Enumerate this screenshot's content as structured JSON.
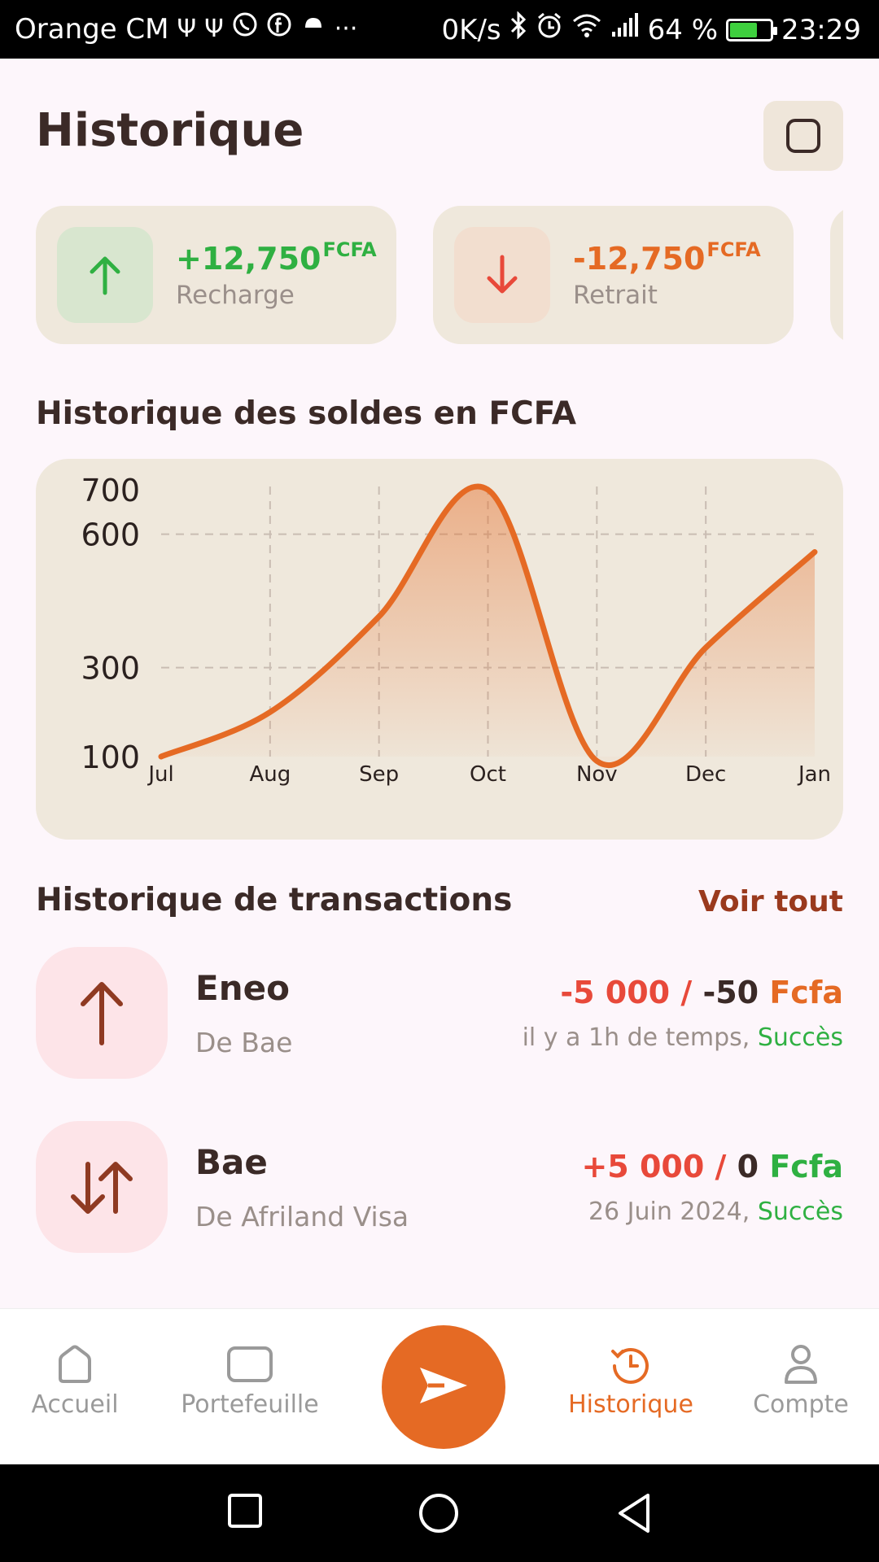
{
  "status_bar": {
    "carrier": "Orange CM",
    "network_speed": "0K/s",
    "battery_percent": "64 %",
    "battery_level": 0.64,
    "time": "23:29",
    "icons": [
      "usb-icon",
      "usb-icon",
      "whatsapp-icon",
      "facebook-icon",
      "notification-icon",
      "more-icon",
      "bluetooth-icon",
      "alarm-icon",
      "wifi-icon",
      "signal-icon",
      "battery-icon"
    ]
  },
  "header": {
    "title": "Historique",
    "action_icon": "square-icon"
  },
  "summary_cards": [
    {
      "amount": "+12,750",
      "currency": "FCFA",
      "label": "Recharge",
      "icon": "arrow-up-icon",
      "color": "#2fb042",
      "icon_bg": "#d8e6cf"
    },
    {
      "amount": "-12,750",
      "currency": "FCFA",
      "label": "Retrait",
      "icon": "arrow-down-icon",
      "color": "#e56a24",
      "icon_bg": "#f2decf"
    }
  ],
  "balance_section": {
    "title": "Historique des soldes en FCFA"
  },
  "chart_data": {
    "type": "area",
    "title": "Historique des soldes en FCFA",
    "x": [
      "Jul",
      "Aug",
      "Sep",
      "Oct",
      "Nov",
      "Dec",
      "Jan"
    ],
    "y_ticks": [
      100,
      300,
      600,
      700
    ],
    "ylim": [
      100,
      700
    ],
    "series": [
      {
        "values": [
          100,
          200,
          415,
          700,
          90,
          345,
          560
        ]
      }
    ],
    "grid": true,
    "line_color": "#e56a24"
  },
  "transactions_section": {
    "title": "Historique de transactions",
    "see_all": "Voir tout"
  },
  "transactions": [
    {
      "name": "Eneo",
      "from": "De Bae",
      "amount": "-5 000 /",
      "fee": "-50",
      "currency": "Fcfa",
      "time": "il y a 1h de temps,",
      "status": "Succès",
      "icon": "arrow-up-icon"
    },
    {
      "name": "Bae",
      "from": "De Afriland Visa",
      "amount": "+5 000 /",
      "fee": "0",
      "currency": "Fcfa",
      "time": "26 Juin 2024,",
      "status": "Succès",
      "icon": "transfer-arrows-icon"
    }
  ],
  "bottom_nav": {
    "items": [
      {
        "label": "Accueil",
        "icon": "home-icon",
        "active": false
      },
      {
        "label": "Portefeuille",
        "icon": "wallet-icon",
        "active": false
      },
      {
        "label": "Historique",
        "icon": "history-icon",
        "active": true
      },
      {
        "label": "Compte",
        "icon": "user-icon",
        "active": false
      }
    ],
    "fab_icon": "send-icon"
  }
}
